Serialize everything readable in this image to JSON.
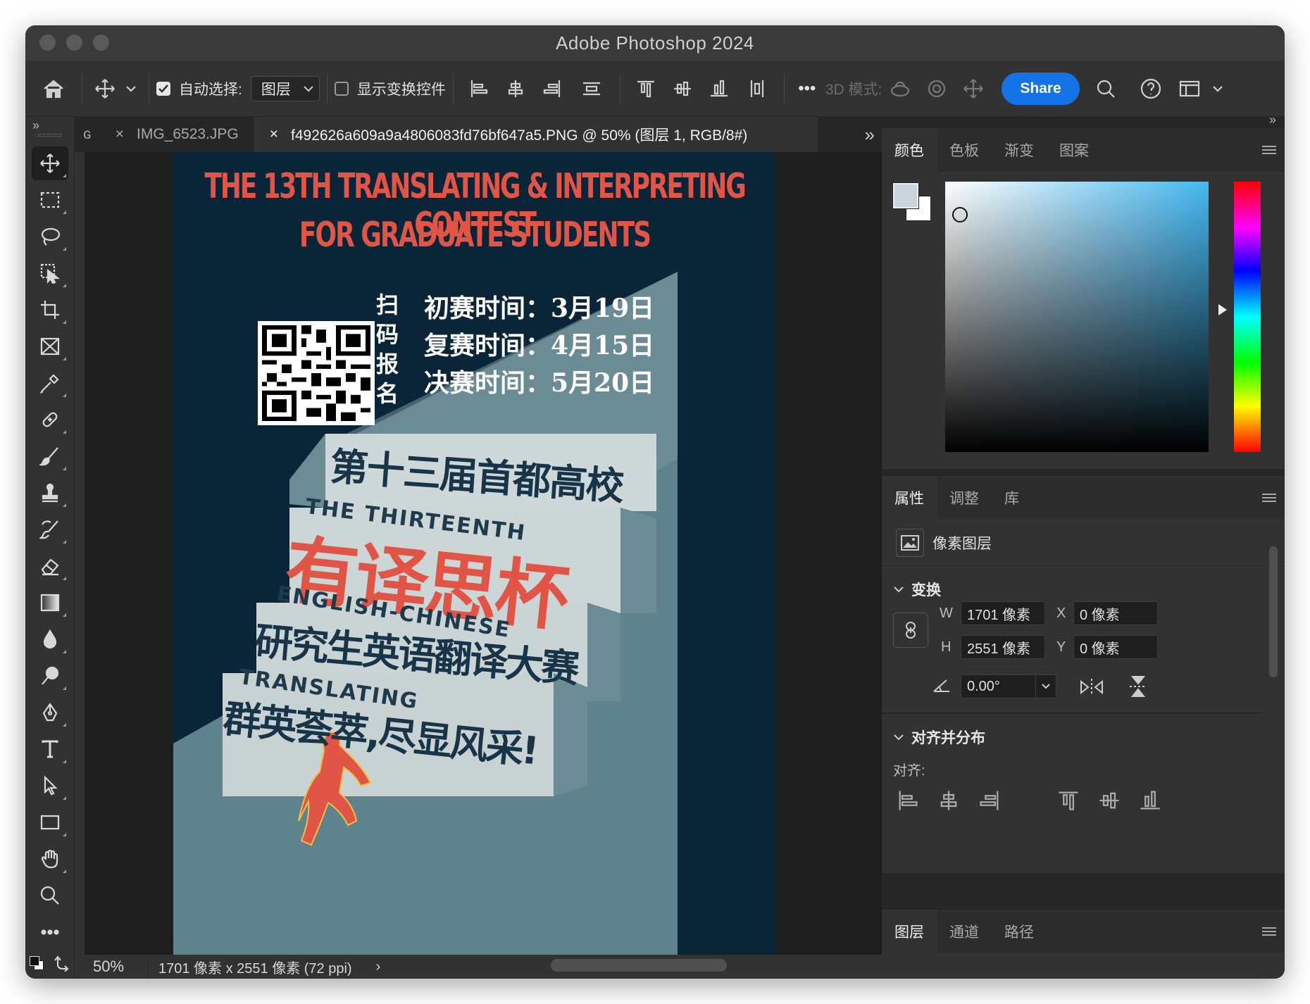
{
  "window": {
    "title": "Adobe Photoshop 2024"
  },
  "options_bar": {
    "auto_select_label": "自动选择:",
    "auto_select_value": "图层",
    "show_transform_label": "显示变换控件",
    "mode_3d_label": "3D 模式:",
    "share_label": "Share",
    "more_label": "•••"
  },
  "tabs": [
    {
      "label": "IMG_6523.JPG",
      "active": false
    },
    {
      "label": "f492626a609a9a4806083fd76bf647a5.PNG @ 50% (图层 1, RGB/8#)",
      "active": true
    }
  ],
  "poster": {
    "title_line1": "THE 13TH TRANSLATING & INTERPRETING CONTEST",
    "title_line2": "FOR GRADUATE STUDENTS",
    "scan_label": [
      "扫",
      "码",
      "报",
      "名"
    ],
    "schedule": [
      "初赛时间：3月19日",
      "复赛时间：4月15日",
      "决赛时间：5月20日"
    ],
    "step1": "第十三届首都高校",
    "step2_en": "THE THIRTEENTH",
    "step2": "有译思杯",
    "step3_en": "ENGLISH-CHINESE",
    "step3": "研究生英语翻译大赛",
    "step4_en": "TRANSLATING",
    "step4": "群英荟萃,尽显风采!"
  },
  "status": {
    "zoom": "50%",
    "doc_info": "1701 像素 x 2551 像素 (72 ppi)"
  },
  "color_panel": {
    "tabs": [
      "颜色",
      "色板",
      "渐变",
      "图案"
    ],
    "active_tab": "颜色",
    "foreground_color": "#c8d5da",
    "background_color": "#ffffff",
    "picker_hue": "#44b8f0"
  },
  "properties_panel": {
    "tabs": [
      "属性",
      "调整",
      "库"
    ],
    "active_tab": "属性",
    "layer_type": "像素图层",
    "transform_header": "变换",
    "w_label": "W",
    "w_value": "1701 像素",
    "h_label": "H",
    "h_value": "2551 像素",
    "x_label": "X",
    "x_value": "0 像素",
    "y_label": "Y",
    "y_value": "0 像素",
    "angle_value": "0.00°",
    "align_header": "对齐并分布",
    "align_label": "对齐:"
  },
  "layers_panel": {
    "tabs": [
      "图层",
      "通道",
      "路径"
    ],
    "active_tab": "图层"
  },
  "colors": {
    "accent": "#1473e6",
    "poster_bg": "#0b2538",
    "poster_red": "#e05546",
    "step_face": "#cfd8d8",
    "step_side": "#6a8a92"
  }
}
